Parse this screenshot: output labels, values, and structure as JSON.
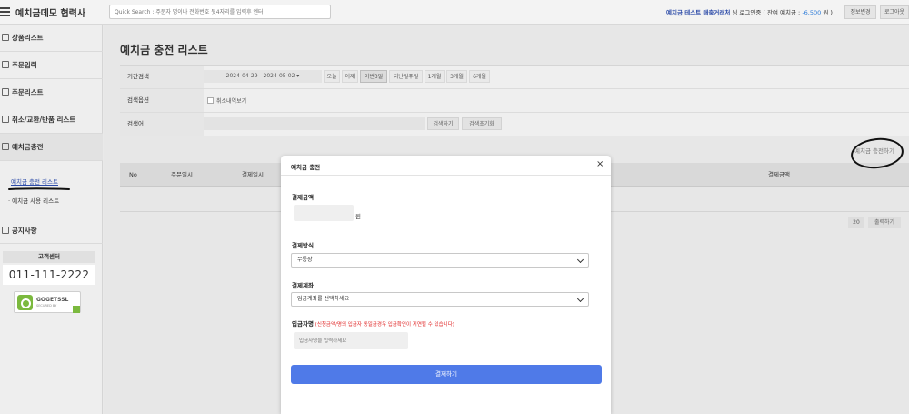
{
  "header": {
    "brand": "예치금데모 협력사",
    "search_placeholder": "Quick Search : 주문자 명이나 전화번호 뒷4자리를 입력후 엔터",
    "user_name": "예치금 테스트 매출거래처",
    "login_text": " 님 로그인중 ( 잔여 예치금 : ",
    "balance": "-6,500",
    "balance_suffix": " 원 )",
    "info_button": "정보변경",
    "logout_button": "로그아웃"
  },
  "sidebar": {
    "items": [
      {
        "label": "상품리스트"
      },
      {
        "label": "주문입력"
      },
      {
        "label": "주문리스트"
      },
      {
        "label": "취소/교환/반품 리스트"
      },
      {
        "label": "예치금충전"
      },
      {
        "label": "공지사항"
      }
    ],
    "sub_items": [
      {
        "label": "예치금 충전 리스트"
      },
      {
        "label": "· 예치금 사용 리스트"
      }
    ],
    "customer_center_title": "고객센터",
    "customer_center_phone": "011-111-2222",
    "ssl_brand": "GOGETSSL",
    "ssl_sub": "SECURED BY"
  },
  "main": {
    "page_title": "예치금 충전 리스트",
    "filter": {
      "period_label": "기간검색",
      "date_range": "2024-04-29 - 2024-05-02 ▾",
      "quick_ranges": [
        "오늘",
        "어제",
        "이번3일",
        "지난일주일",
        "1개월",
        "3개월",
        "6개월"
      ],
      "options_label": "검색옵션",
      "cancel_checkbox_label": "취소내역보기",
      "keyword_label": "검색어",
      "search_button": "검색하기",
      "reset_button": "검색초기화"
    },
    "charge_button": "예치금 충전하기",
    "table_headers": [
      "No",
      "주문일시",
      "결제일시",
      "결제금액"
    ],
    "page_size": "20",
    "page_size_button": "출력하기"
  },
  "modal": {
    "title": "예치금 충전",
    "close_symbol": "×",
    "amount_label": "결제금액",
    "currency": "원",
    "method_label": "결제방식",
    "method_value": "무통장",
    "account_label": "결제계좌",
    "account_placeholder": "입금계좌를 선택하세요",
    "depositor_label": "입금자명",
    "depositor_note": " (신청금액/명의 입금자 동일금경우 입금확인이 지연될 수 있습니다)",
    "depositor_placeholder": "입금자명을 입력하세요",
    "pay_button": "결제하기"
  }
}
